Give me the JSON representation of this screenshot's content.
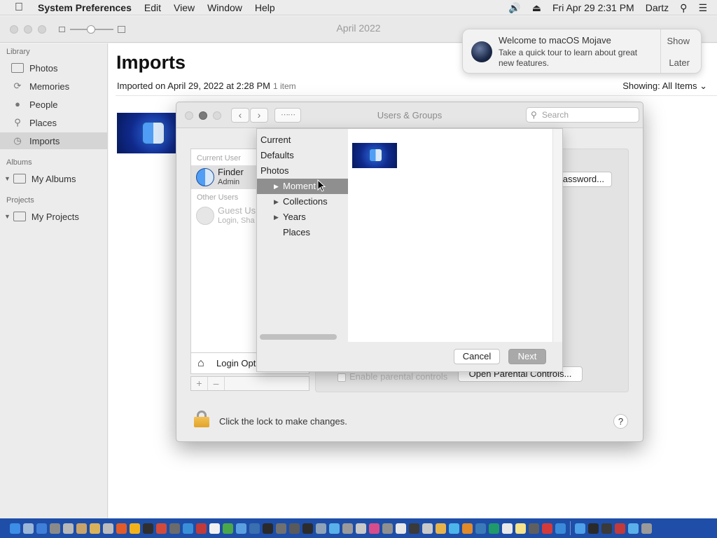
{
  "menubar": {
    "app_name": "System Preferences",
    "menus": [
      "Edit",
      "View",
      "Window",
      "Help"
    ],
    "clock": "Fri Apr 29  2:31 PM",
    "user": "Dartz"
  },
  "photos": {
    "window_title": "April 2022",
    "sidebar": {
      "library_heading": "Library",
      "library_items": [
        "Photos",
        "Memories",
        "People",
        "Places",
        "Imports"
      ],
      "albums_heading": "Albums",
      "albums_item": "My Albums",
      "projects_heading": "Projects",
      "projects_item": "My Projects"
    },
    "main": {
      "title": "Imports",
      "imported_on": "Imported on April 29, 2022 at 2:28 PM",
      "item_count": "1 item",
      "showing_label": "Showing:",
      "showing_value": "All Items"
    }
  },
  "notification": {
    "title": "Welcome to macOS Mojave",
    "body": "Take a quick tour to learn about great new features.",
    "show_label": "Show",
    "later_label": "Later"
  },
  "users_groups": {
    "title": "Users & Groups",
    "search_placeholder": "Search",
    "current_user_heading": "Current User",
    "current_user_name": "Finder",
    "current_user_role": "Admin",
    "other_users_heading": "Other Users",
    "guest_name": "Guest Us",
    "guest_sub": "Login, Sha",
    "login_options": "Login Opt",
    "password_button": "assword...",
    "parental_checkbox": "Enable parental controls",
    "parental_button": "Open Parental Controls...",
    "lock_text": "Click the lock to make changes.",
    "help_label": "?"
  },
  "sheet": {
    "sources_top": [
      "Current",
      "Defaults",
      "Photos"
    ],
    "photos_children": [
      {
        "label": "Moment",
        "expandable": true
      },
      {
        "label": "Collections",
        "expandable": true
      },
      {
        "label": "Years",
        "expandable": true
      },
      {
        "label": "Places",
        "expandable": false
      }
    ],
    "cancel_label": "Cancel",
    "next_label": "Next"
  },
  "dock": {
    "icon_colors": [
      "#3c8ee6",
      "#9bb7d8",
      "#3f7fd9",
      "#8a8a8a",
      "#b8b8b8",
      "#c9a46a",
      "#d9b25a",
      "#bcbcbc",
      "#e25c2a",
      "#f4b21a",
      "#2f2f2f",
      "#d24a3a",
      "#6b6b6b",
      "#3a8fd9",
      "#c23a3a",
      "#f0f0f0",
      "#4aa84a",
      "#5aa0e0",
      "#3a6fb0",
      "#2a2a2a",
      "#707070",
      "#5a5a5a",
      "#2c2c2c",
      "#8fa3b8",
      "#5ab0e8",
      "#9a9a9a",
      "#c8c8c8",
      "#d74d8b",
      "#8f8f8f",
      "#e7e7e7",
      "#3a3a3a",
      "#c9c9c9",
      "#e8b44a",
      "#4cb5ea",
      "#e08a2a",
      "#3a7ab8",
      "#1f9a6a",
      "#e8e8e8",
      "#f6e38a",
      "#5f5f5f",
      "#d43a3a",
      "#3a8ad9",
      "#4ea0e8",
      "#2a2a2a",
      "#3a3a3a",
      "#c23a3a",
      "#5ab0e8",
      "#9a9a9a"
    ]
  }
}
